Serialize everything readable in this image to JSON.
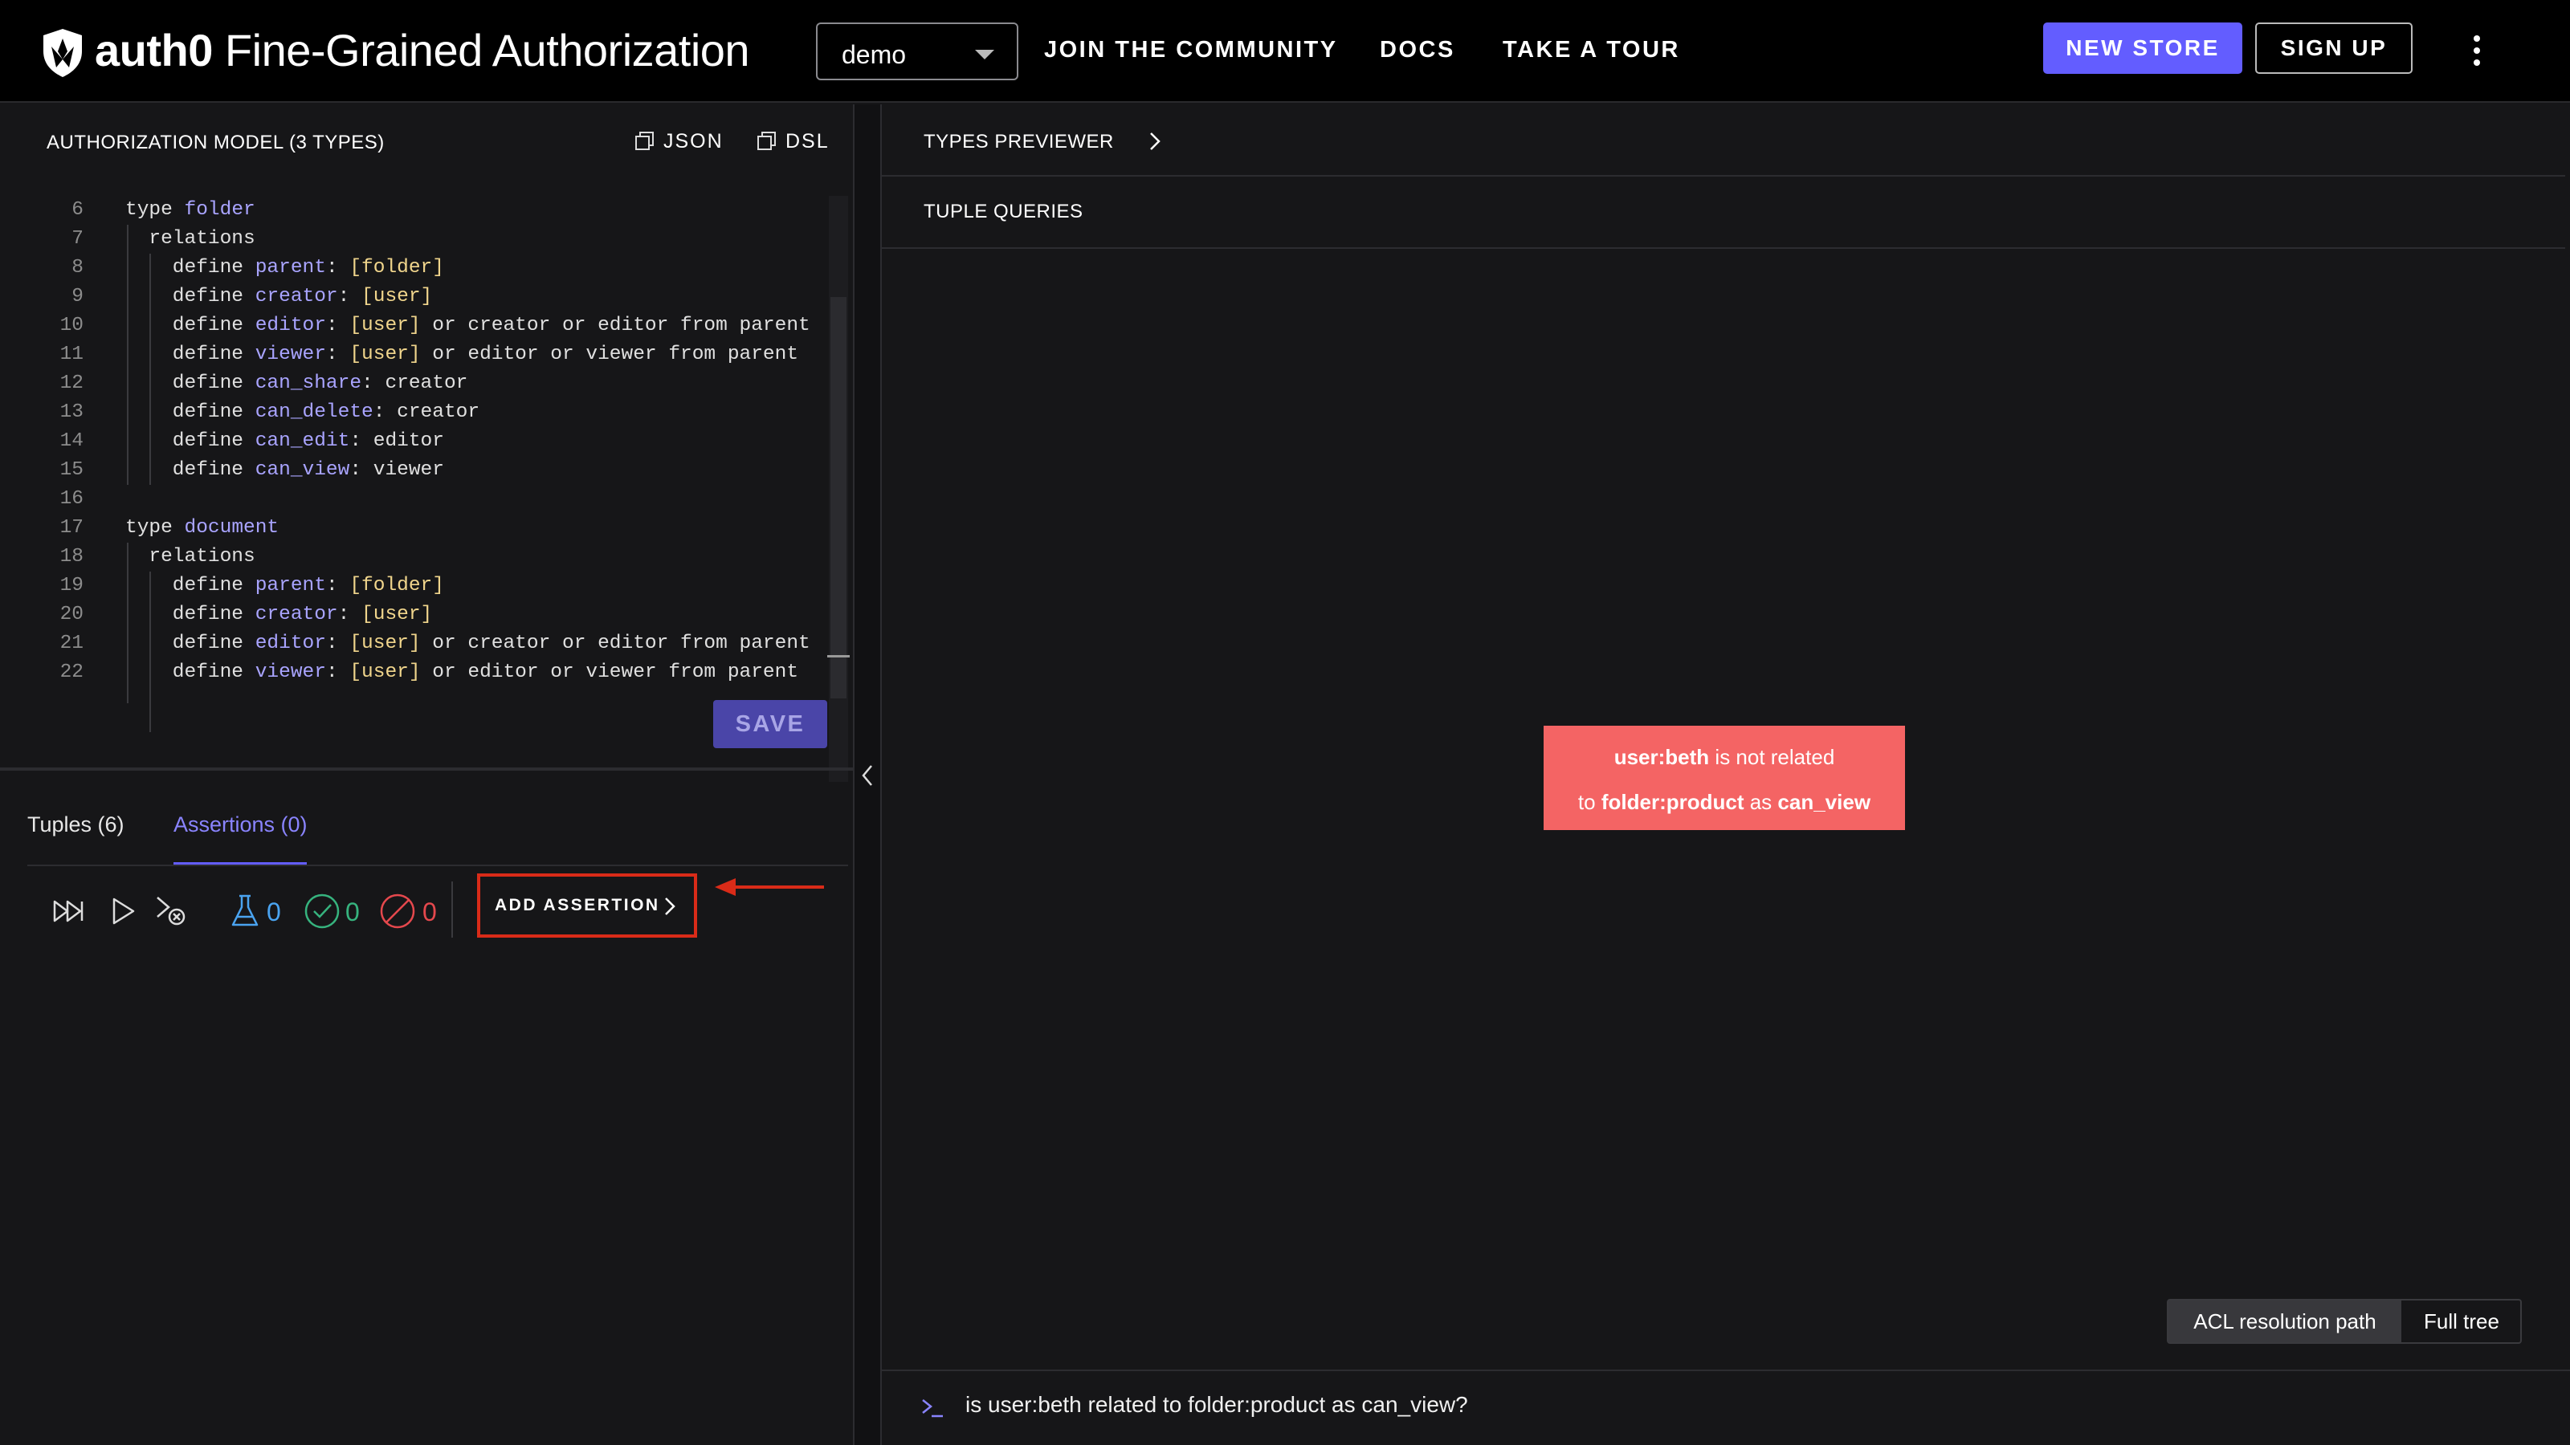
{
  "header": {
    "brand_name": "auth0",
    "product_name": "Fine-Grained Authorization",
    "store_selector": "demo",
    "nav": [
      "JOIN THE COMMUNITY",
      "DOCS",
      "TAKE A TOUR"
    ],
    "new_store_label": "NEW STORE",
    "sign_up_label": "SIGN UP",
    "accent_color": "#635dff"
  },
  "model": {
    "title": "AUTHORIZATION MODEL (3 TYPES)",
    "json_label": "JSON",
    "dsl_label": "DSL",
    "save_label": "SAVE",
    "lines": [
      {
        "n": "6",
        "indent": 0,
        "tokens": [
          [
            "kw",
            "type "
          ],
          [
            "nm",
            "folder"
          ]
        ]
      },
      {
        "n": "7",
        "indent": 1,
        "tokens": [
          [
            "kw",
            "relations"
          ]
        ]
      },
      {
        "n": "8",
        "indent": 2,
        "tokens": [
          [
            "kw",
            "define "
          ],
          [
            "nm",
            "parent"
          ],
          [
            "kw",
            ": "
          ],
          [
            "ty",
            "[folder]"
          ]
        ]
      },
      {
        "n": "9",
        "indent": 2,
        "tokens": [
          [
            "kw",
            "define "
          ],
          [
            "nm",
            "creator"
          ],
          [
            "kw",
            ": "
          ],
          [
            "ty",
            "[user]"
          ]
        ]
      },
      {
        "n": "10",
        "indent": 2,
        "tokens": [
          [
            "kw",
            "define "
          ],
          [
            "nm",
            "editor"
          ],
          [
            "kw",
            ": "
          ],
          [
            "ty",
            "[user]"
          ],
          [
            "kw",
            " or creator or editor from parent"
          ]
        ]
      },
      {
        "n": "11",
        "indent": 2,
        "tokens": [
          [
            "kw",
            "define "
          ],
          [
            "nm",
            "viewer"
          ],
          [
            "kw",
            ": "
          ],
          [
            "ty",
            "[user]"
          ],
          [
            "kw",
            " or editor or viewer from parent"
          ]
        ]
      },
      {
        "n": "12",
        "indent": 2,
        "tokens": [
          [
            "kw",
            "define "
          ],
          [
            "nm",
            "can_share"
          ],
          [
            "kw",
            ": creator"
          ]
        ]
      },
      {
        "n": "13",
        "indent": 2,
        "tokens": [
          [
            "kw",
            "define "
          ],
          [
            "nm",
            "can_delete"
          ],
          [
            "kw",
            ": creator"
          ]
        ]
      },
      {
        "n": "14",
        "indent": 2,
        "tokens": [
          [
            "kw",
            "define "
          ],
          [
            "nm",
            "can_edit"
          ],
          [
            "kw",
            ": editor"
          ]
        ]
      },
      {
        "n": "15",
        "indent": 2,
        "tokens": [
          [
            "kw",
            "define "
          ],
          [
            "nm",
            "can_view"
          ],
          [
            "kw",
            ": viewer"
          ]
        ]
      },
      {
        "n": "16",
        "indent": 0,
        "tokens": []
      },
      {
        "n": "17",
        "indent": 0,
        "tokens": [
          [
            "kw",
            "type "
          ],
          [
            "nm",
            "document"
          ]
        ]
      },
      {
        "n": "18",
        "indent": 1,
        "tokens": [
          [
            "kw",
            "relations"
          ]
        ]
      },
      {
        "n": "19",
        "indent": 2,
        "tokens": [
          [
            "kw",
            "define "
          ],
          [
            "nm",
            "parent"
          ],
          [
            "kw",
            ": "
          ],
          [
            "ty",
            "[folder]"
          ]
        ]
      },
      {
        "n": "20",
        "indent": 2,
        "tokens": [
          [
            "kw",
            "define "
          ],
          [
            "nm",
            "creator"
          ],
          [
            "kw",
            ": "
          ],
          [
            "ty",
            "[user]"
          ]
        ]
      },
      {
        "n": "21",
        "indent": 2,
        "tokens": [
          [
            "kw",
            "define "
          ],
          [
            "nm",
            "editor"
          ],
          [
            "kw",
            ": "
          ],
          [
            "ty",
            "[user]"
          ],
          [
            "kw",
            " or creator or editor from parent"
          ]
        ]
      },
      {
        "n": "22",
        "indent": 2,
        "tokens": [
          [
            "kw",
            "define "
          ],
          [
            "nm",
            "viewer"
          ],
          [
            "kw",
            ": "
          ],
          [
            "ty",
            "[user]"
          ],
          [
            "kw",
            " or editor or viewer from parent"
          ]
        ]
      }
    ]
  },
  "bottom_tabs": {
    "tuples": "Tuples (6)",
    "assertions": "Assertions (0)"
  },
  "assertions_bar": {
    "total_count": "0",
    "passed_count": "0",
    "failed_count": "0",
    "add_label": "ADD ASSERTION",
    "count_colors": {
      "total": "#4aa3f0",
      "passed": "#36b37e",
      "failed": "#e5484d"
    }
  },
  "right": {
    "types_previewer": "TYPES PREVIEWER",
    "tuple_queries": "TUPLE QUERIES",
    "result": {
      "user": "user:beth",
      "not_related": " is not related",
      "to": "to ",
      "object": "folder:product",
      "as": " as ",
      "relation": "can_view",
      "color": "#f46464"
    },
    "view_modes": [
      "ACL resolution path",
      "Full tree"
    ],
    "query": "is user:beth related to folder:product as can_view?"
  }
}
